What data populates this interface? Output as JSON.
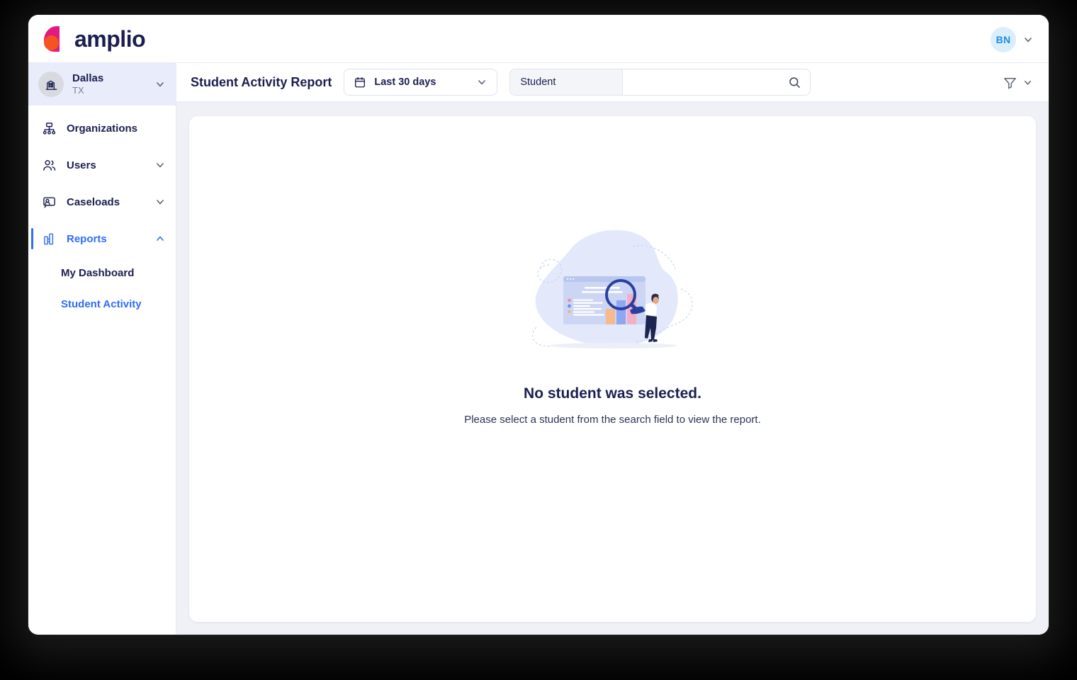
{
  "brand": {
    "name": "amplio",
    "logo_icon": "amplio-logo-icon",
    "accent_orange": "#f4541f",
    "accent_pink": "#e4197f",
    "navy": "#1b1f50",
    "blue": "#2f6df6"
  },
  "header": {
    "avatar_initials": "BN",
    "avatar_chevron_icon": "chevron-down-icon"
  },
  "sidebar": {
    "org": {
      "name": "Dallas",
      "state": "TX",
      "icon": "building-icon",
      "chevron_icon": "chevron-down-icon"
    },
    "items": [
      {
        "label": "Organizations",
        "icon": "org-chart-icon",
        "has_chevron": false,
        "active": false
      },
      {
        "label": "Users",
        "icon": "users-icon",
        "has_chevron": true,
        "active": false
      },
      {
        "label": "Caseloads",
        "icon": "caseload-icon",
        "has_chevron": true,
        "active": false
      },
      {
        "label": "Reports",
        "icon": "bar-chart-icon",
        "has_chevron": true,
        "active": true
      }
    ],
    "sub_items": [
      {
        "label": "My Dashboard",
        "active": false
      },
      {
        "label": "Student Activity",
        "active": true
      }
    ]
  },
  "toolbar": {
    "title": "Student Activity Report",
    "date_range": {
      "value": "Last 30 days",
      "icon": "calendar-icon",
      "chevron_icon": "chevron-down-icon"
    },
    "search": {
      "tag_label": "Student",
      "value": "",
      "placeholder": "",
      "icon": "search-icon"
    },
    "filter": {
      "icon": "filter-funnel-icon",
      "chevron_icon": "chevron-down-icon"
    }
  },
  "empty_state": {
    "illustration": "student-report-search-illustration",
    "title": "No student was selected.",
    "subtitle": "Please select a student from the search field to view the report."
  }
}
